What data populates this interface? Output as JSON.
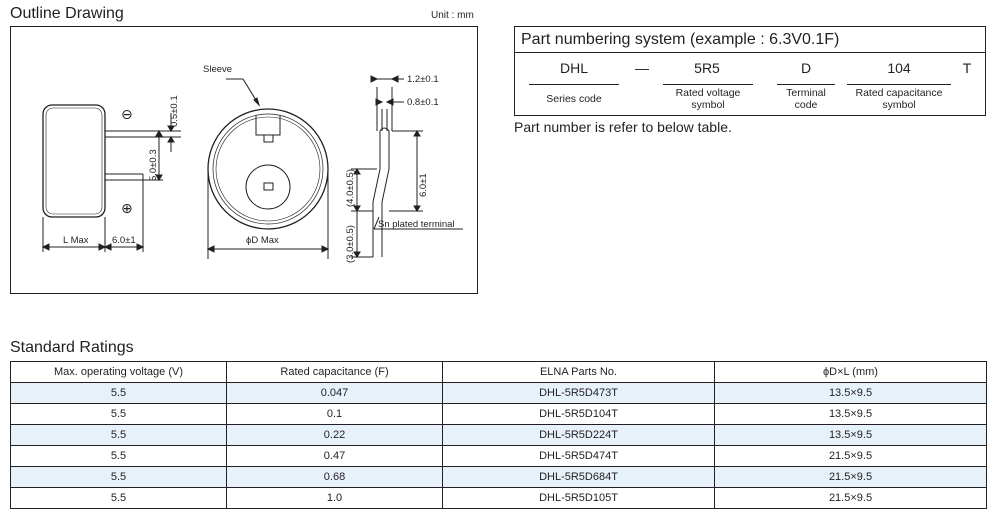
{
  "outline": {
    "title": "Outline Drawing",
    "unit": "Unit : mm",
    "labels": {
      "sleeve": "Sleeve",
      "minus": "⊖",
      "plus": "⊕",
      "dim_05": "0.5±0.1",
      "dim_50": "5.0±0.3",
      "l_max": "L Max",
      "lead_60": "6.0±1",
      "phi_d_max": "ϕD Max",
      "dim_12": "1.2±0.1",
      "dim_08": "0.8±0.1",
      "dim_40": "(4.0±0.5)",
      "dim_30": "(3.0±0.5)",
      "dim_60": "6.0±1",
      "sn_terminal": "Sn plated terminal"
    }
  },
  "part_numbering": {
    "title": "Part numbering system (example : 6.3V0.1F)",
    "codes": [
      "DHL",
      "—",
      "5R5",
      "D",
      "104",
      "T"
    ],
    "labels": [
      "Series code",
      "Rated voltage\nsymbol",
      "Terminal\ncode",
      "Rated capacitance\nsymbol"
    ],
    "note": "Part number is refer to below table."
  },
  "ratings": {
    "title": "Standard Ratings",
    "columns": [
      "Max. operating voltage (V)",
      "Rated capacitance (F)",
      "ELNA Parts No.",
      "ϕD×L (mm)"
    ],
    "rows": [
      [
        "5.5",
        "0.047",
        "DHL-5R5D473T",
        "13.5×9.5"
      ],
      [
        "5.5",
        "0.1",
        "DHL-5R5D104T",
        "13.5×9.5"
      ],
      [
        "5.5",
        "0.22",
        "DHL-5R5D224T",
        "13.5×9.5"
      ],
      [
        "5.5",
        "0.47",
        "DHL-5R5D474T",
        "21.5×9.5"
      ],
      [
        "5.5",
        "0.68",
        "DHL-5R5D684T",
        "21.5×9.5"
      ],
      [
        "5.5",
        "1.0",
        "DHL-5R5D105T",
        "21.5×9.5"
      ]
    ],
    "shaded_color": "#e6f1f9"
  }
}
